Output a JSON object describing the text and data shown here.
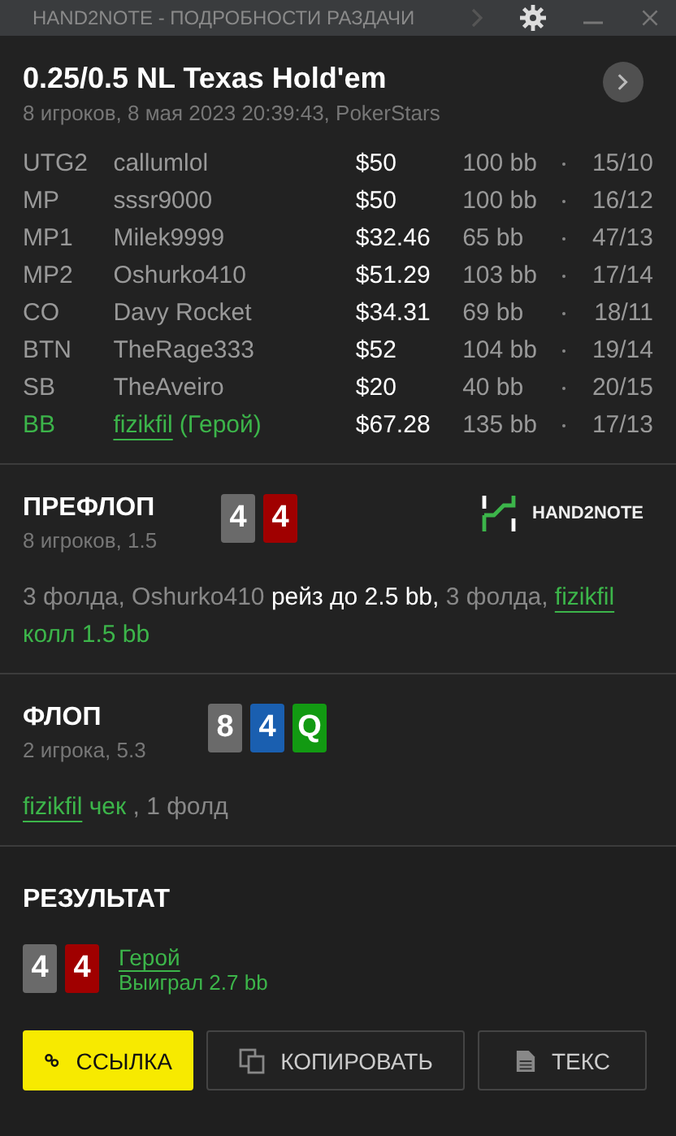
{
  "window": {
    "title": "HAND2NOTE - ПОДРОБНОСТИ РАЗДАЧИ"
  },
  "header": {
    "title": "0.25/0.5 NL Texas Hold'em",
    "subtitle": "8 игроков, 8 мая 2023 20:39:43, PokerStars"
  },
  "players": [
    {
      "position": "UTG2",
      "name": "callumlol",
      "stack": "$50",
      "bb": "100 bb",
      "stats": "15/10",
      "hero": false
    },
    {
      "position": "MP",
      "name": "sssr9000",
      "stack": "$50",
      "bb": "100 bb",
      "stats": "16/12",
      "hero": false
    },
    {
      "position": "MP1",
      "name": "Milek9999",
      "stack": "$32.46",
      "bb": "65 bb",
      "stats": "47/13",
      "hero": false
    },
    {
      "position": "MP2",
      "name": "Oshurko410",
      "stack": "$51.29",
      "bb": "103 bb",
      "stats": "17/14",
      "hero": false
    },
    {
      "position": "CO",
      "name": "Davy Rocket",
      "stack": "$34.31",
      "bb": "69 bb",
      "stats": "18/11",
      "hero": false
    },
    {
      "position": "BTN",
      "name": "TheRage333",
      "stack": "$52",
      "bb": "104 bb",
      "stats": "19/14",
      "hero": false
    },
    {
      "position": "SB",
      "name": "TheAveiro",
      "stack": "$20",
      "bb": "40 bb",
      "stats": "20/15",
      "hero": false
    },
    {
      "position": "BB",
      "name": "fizikfil",
      "hero_tag": "(Герой)",
      "stack": "$67.28",
      "bb": "135 bb",
      "stats": "17/13",
      "hero": true
    }
  ],
  "streets": [
    {
      "title": "ПРЕФЛОП",
      "info": "8 игроков, 1.5",
      "logo": "HAND2NOTE",
      "cards": [
        {
          "rank": "4",
          "color": "#6a6a6a"
        },
        {
          "rank": "4",
          "color": "#a00000"
        }
      ],
      "actions": [
        {
          "kind": "plain",
          "text": "3 фолда, Oshurko410 "
        },
        {
          "kind": "action",
          "text": "рейз до 2.5 bb,"
        },
        {
          "kind": "plain",
          "text": " 3 фолда, "
        },
        {
          "kind": "hero",
          "text": "fizikfil"
        },
        {
          "kind": "hero_action",
          "text": " колл 1.5 bb"
        }
      ]
    },
    {
      "title": "ФЛОП",
      "info": "2 игрока, 5.3",
      "cards": [
        {
          "rank": "8",
          "color": "#6a6a6a"
        },
        {
          "rank": "4",
          "color": "#1a5fb0"
        },
        {
          "rank": "Q",
          "color": "#129a12"
        }
      ],
      "actions": [
        {
          "kind": "hero",
          "text": "fizikfil"
        },
        {
          "kind": "hero_action",
          "text": " чек "
        },
        {
          "kind": "plain",
          "text": ", 1 фолд"
        }
      ]
    }
  ],
  "result": {
    "title": "РЕЗУЛЬТАТ",
    "cards": [
      {
        "rank": "4",
        "color": "#6a6a6a"
      },
      {
        "rank": "4",
        "color": "#a00000"
      }
    ],
    "player": "Герой",
    "outcome": "Выиграл 2.7 bb"
  },
  "buttons": [
    {
      "kind": "link",
      "label": "ССЫЛКА",
      "primary": true
    },
    {
      "kind": "copy",
      "label": "КОПИРОВАТЬ",
      "primary": false
    },
    {
      "kind": "text",
      "label": "ТЕКС",
      "primary": false
    }
  ]
}
